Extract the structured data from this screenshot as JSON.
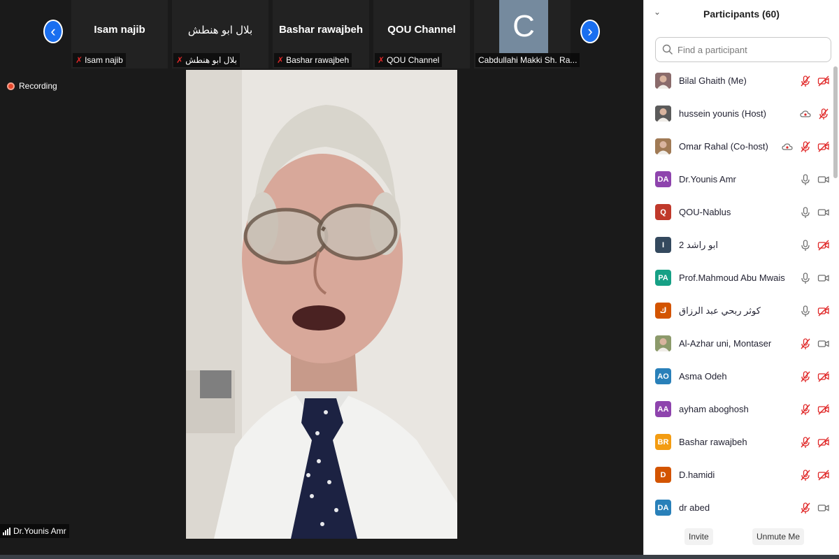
{
  "thumbnails": [
    {
      "display": "Isam najib",
      "label": "Isam najib",
      "muted": true
    },
    {
      "display": "بلال ابو هنطش",
      "label": "بلال ابو هنطش",
      "muted": true
    },
    {
      "display": "Bashar rawajbeh",
      "label": "Bashar rawajbeh",
      "muted": true
    },
    {
      "display": "QOU Channel",
      "label": "QOU Channel",
      "muted": true
    },
    {
      "initial": "C",
      "label": "Cabdullahi Makki Sh. Ra...",
      "muted": false
    }
  ],
  "nav": {
    "prev_icon": "‹",
    "next_icon": "›"
  },
  "recording": {
    "label": "Recording"
  },
  "active_speaker": {
    "name": "Dr.Younis Amr"
  },
  "panel": {
    "title": "Participants (60)",
    "search_placeholder": "Find a participant",
    "invite_label": "Invite",
    "unmute_label": "Unmute Me"
  },
  "participants": [
    {
      "name": "Bilal Ghaith (Me)",
      "avatar": "photo",
      "color": "#8a6b6b",
      "mic": "muted",
      "video": "off",
      "extra": ""
    },
    {
      "name": "hussein younis (Host)",
      "avatar": "photo",
      "color": "#5b5b5b",
      "mic": "muted",
      "video": "",
      "extra": "cloud"
    },
    {
      "name": "Omar Rahal (Co-host)",
      "avatar": "photo",
      "color": "#a07a55",
      "mic": "muted",
      "video": "off",
      "extra": "cloud"
    },
    {
      "name": "Dr.Younis Amr",
      "avatar": "DA",
      "color": "#8e44ad",
      "mic": "on",
      "video": "on",
      "extra": ""
    },
    {
      "name": "QOU-Nablus",
      "avatar": "Q",
      "color": "#c0392b",
      "mic": "on",
      "video": "on",
      "extra": ""
    },
    {
      "name": "ابو راشد 2",
      "avatar": "I",
      "color": "#34495e",
      "mic": "on",
      "video": "off",
      "extra": ""
    },
    {
      "name": "Prof.Mahmoud Abu Mwais",
      "avatar": "PA",
      "color": "#16a085",
      "mic": "on",
      "video": "on",
      "extra": ""
    },
    {
      "name": "كوثر ربحي عبد الرزاق",
      "avatar": "ك",
      "color": "#d35400",
      "mic": "on",
      "video": "off",
      "extra": ""
    },
    {
      "name": "Al-Azhar uni, Montaser",
      "avatar": "photo",
      "color": "#8c9a6b",
      "mic": "muted",
      "video": "on",
      "extra": ""
    },
    {
      "name": "Asma Odeh",
      "avatar": "AO",
      "color": "#2980b9",
      "mic": "muted",
      "video": "off",
      "extra": ""
    },
    {
      "name": "ayham aboghosh",
      "avatar": "AA",
      "color": "#8e44ad",
      "mic": "muted",
      "video": "off",
      "extra": ""
    },
    {
      "name": "Bashar rawajbeh",
      "avatar": "BR",
      "color": "#f39c12",
      "mic": "muted",
      "video": "off",
      "extra": ""
    },
    {
      "name": "D.hamidi",
      "avatar": "D",
      "color": "#d35400",
      "mic": "muted",
      "video": "off",
      "extra": ""
    },
    {
      "name": "dr abed",
      "avatar": "DA",
      "color": "#2980b9",
      "mic": "muted",
      "video": "on",
      "extra": ""
    }
  ]
}
